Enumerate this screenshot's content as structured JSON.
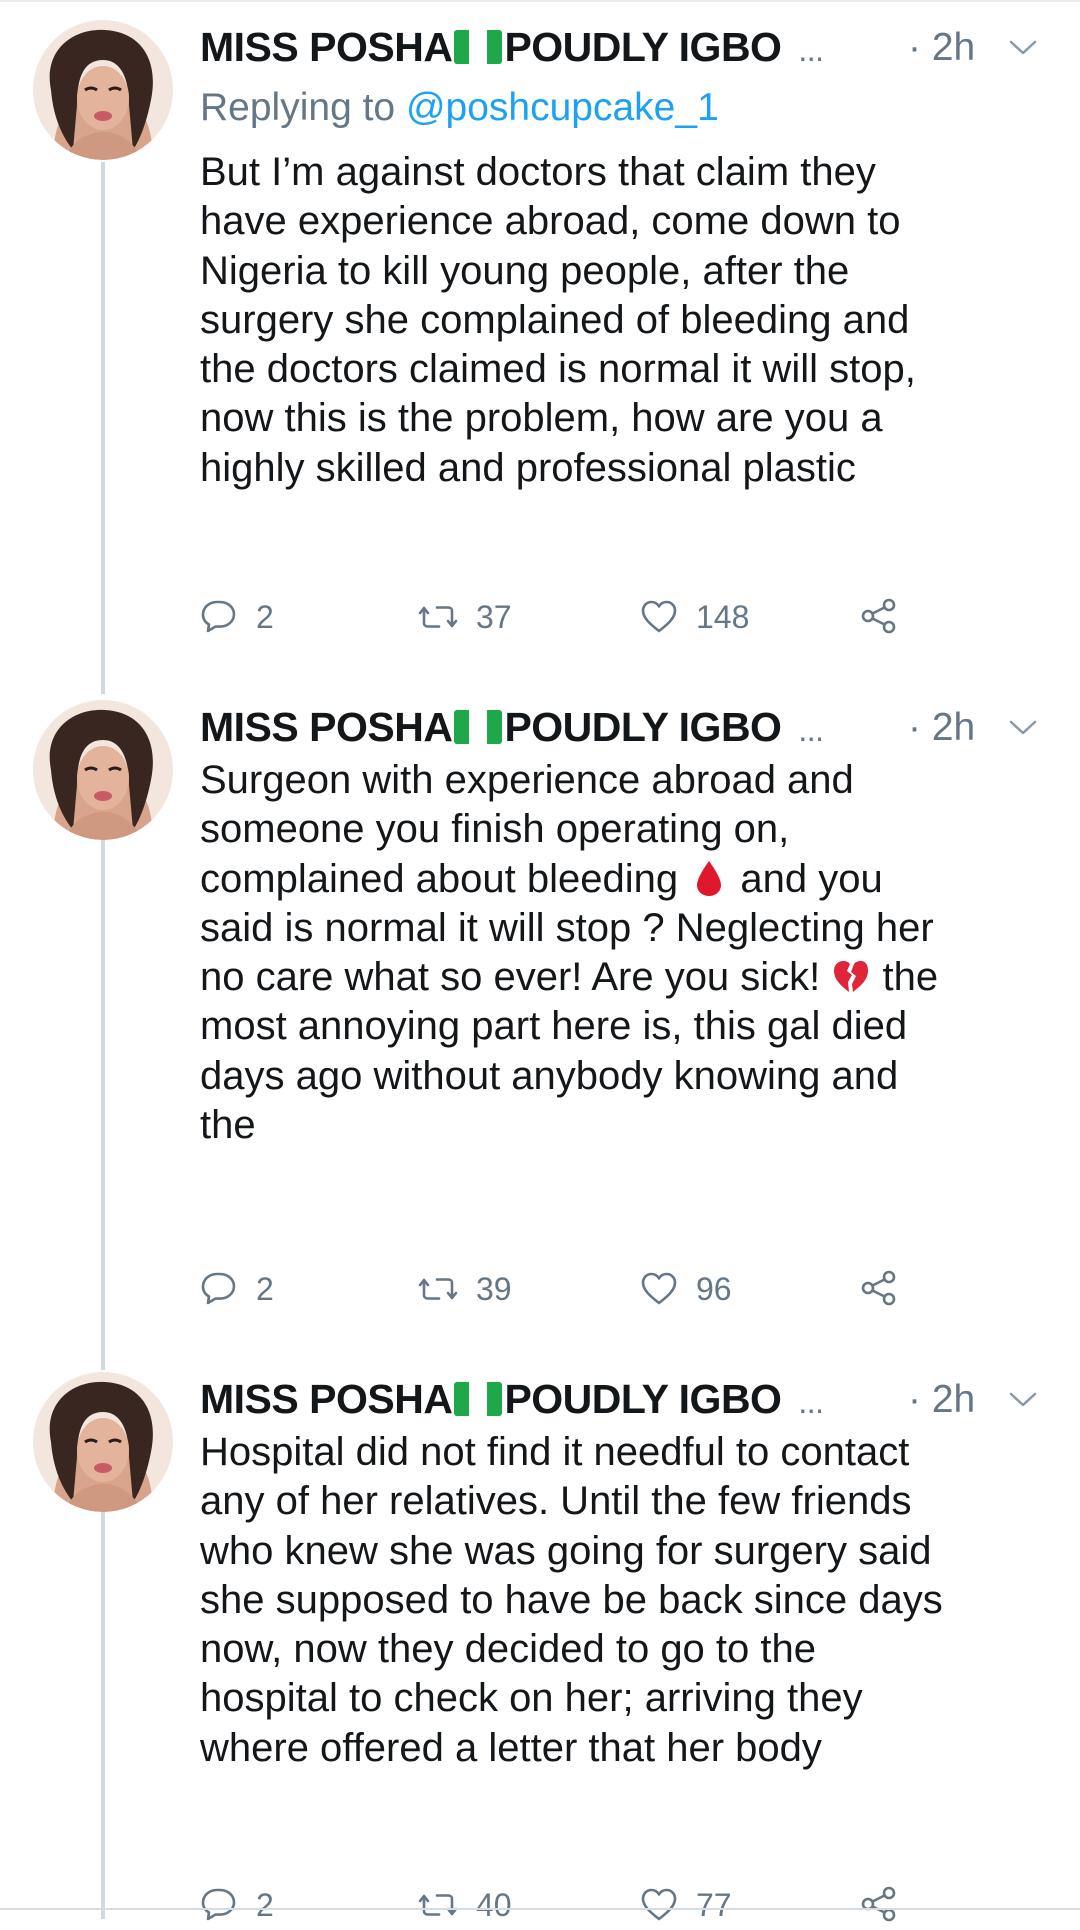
{
  "tweets": [
    {
      "author": {
        "name_part1": "MISS POSHA",
        "name_part2": "POUDLY IGBO",
        "ellipsis": "...",
        "flag_icon": "nigeria-flag",
        "avatar_icon": "profile-photo"
      },
      "time": "· 2h",
      "replying_to": {
        "prefix": "Replying to ",
        "handle": "@poshcupcake_1"
      },
      "text_lines": [
        "But I’m against doctors that claim they",
        "have experience abroad, come down to",
        "Nigeria to kill young people, after the",
        "surgery she complained of bleeding and",
        "the doctors claimed is normal it will stop,",
        "now this is the problem, how are you a",
        "highly skilled and professional plastic"
      ],
      "counts": {
        "replies": "2",
        "retweets": "37",
        "likes": "148"
      }
    },
    {
      "author": {
        "name_part1": "MISS POSHA",
        "name_part2": "POUDLY IGBO",
        "ellipsis": "...",
        "flag_icon": "nigeria-flag",
        "avatar_icon": "profile-photo"
      },
      "time": "· 2h",
      "text_lines": [
        "Surgeon with experience abroad and",
        "someone you finish operating on,"
      ],
      "line3": {
        "before": "complained about bleeding ",
        "emoji": "drop-of-blood-emoji",
        "after": " and you"
      },
      "line4": "said is normal it will stop ? Neglecting her",
      "line5": {
        "before": "no care what so ever! Are you sick! ",
        "emoji": "broken-heart-emoji",
        "after": " the"
      },
      "text_lines_end": [
        "most annoying part here is, this gal died",
        "days ago without anybody knowing and",
        "the"
      ],
      "counts": {
        "replies": "2",
        "retweets": "39",
        "likes": "96"
      }
    },
    {
      "author": {
        "name_part1": "MISS POSHA",
        "name_part2": "POUDLY IGBO",
        "ellipsis": "...",
        "flag_icon": "nigeria-flag",
        "avatar_icon": "profile-photo"
      },
      "time": "· 2h",
      "text_lines": [
        "Hospital did not find it needful to contact",
        "any of her relatives. Until the few friends",
        "who knew she was going for surgery said",
        "she supposed to have be back since days",
        "now, now they decided to go to the",
        "hospital to check on her; arriving they",
        "where offered a letter that her body"
      ],
      "counts": {
        "replies": "2",
        "retweets": "40",
        "likes": "77"
      }
    }
  ],
  "colors": {
    "text": "#14171a",
    "secondary": "#657786",
    "link": "#1da1f2",
    "thread_line": "#cfd9de",
    "flag_green": "#1fa84a"
  },
  "icons": {
    "reply": "reply-icon",
    "retweet": "retweet-icon",
    "like": "heart-icon",
    "share": "share-icon",
    "menu": "chevron-down-icon"
  }
}
